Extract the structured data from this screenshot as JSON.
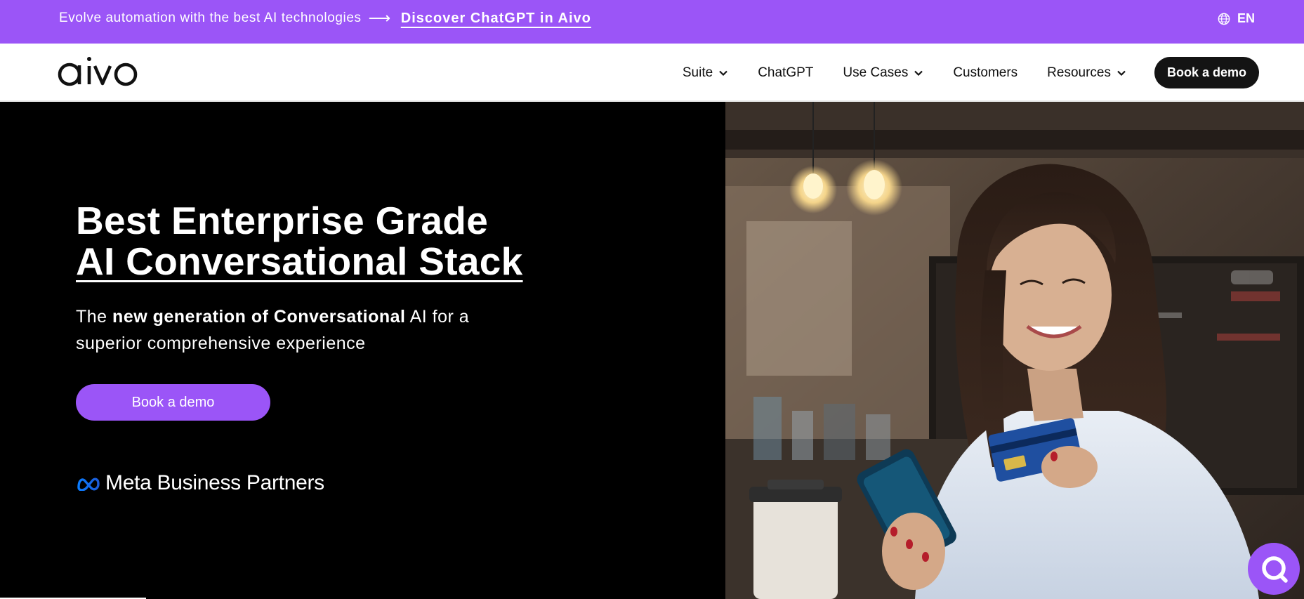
{
  "topbar": {
    "promo_text": "Evolve automation with the best AI technologies",
    "promo_arrow": "⟶",
    "promo_link": "Discover ChatGPT in Aivo",
    "language": "EN",
    "background": "#9b55f7"
  },
  "header": {
    "logo_text": "aivo",
    "nav": [
      {
        "label": "Suite",
        "has_dropdown": true
      },
      {
        "label": "ChatGPT",
        "has_dropdown": false
      },
      {
        "label": "Use Cases",
        "has_dropdown": true
      },
      {
        "label": "Customers",
        "has_dropdown": false
      },
      {
        "label": "Resources",
        "has_dropdown": true
      }
    ],
    "cta_label": "Book a demo"
  },
  "hero": {
    "title_line1": "Best Enterprise Grade",
    "title_line2": "AI Conversational Stack",
    "subtitle_prefix": "The",
    "subtitle_bold": "new generation of Conversational",
    "subtitle_suffix": "AI for a superior comprehensive experience",
    "cta_label": "Book a demo",
    "partner_badge": "Meta Business Partners"
  },
  "colors": {
    "accent": "#9b55f7",
    "dark": "#141414"
  },
  "icons": {
    "language": "globe-icon",
    "dropdown": "chevron-down-icon",
    "chat": "chat-bubble-icon",
    "meta": "meta-infinity-icon"
  }
}
